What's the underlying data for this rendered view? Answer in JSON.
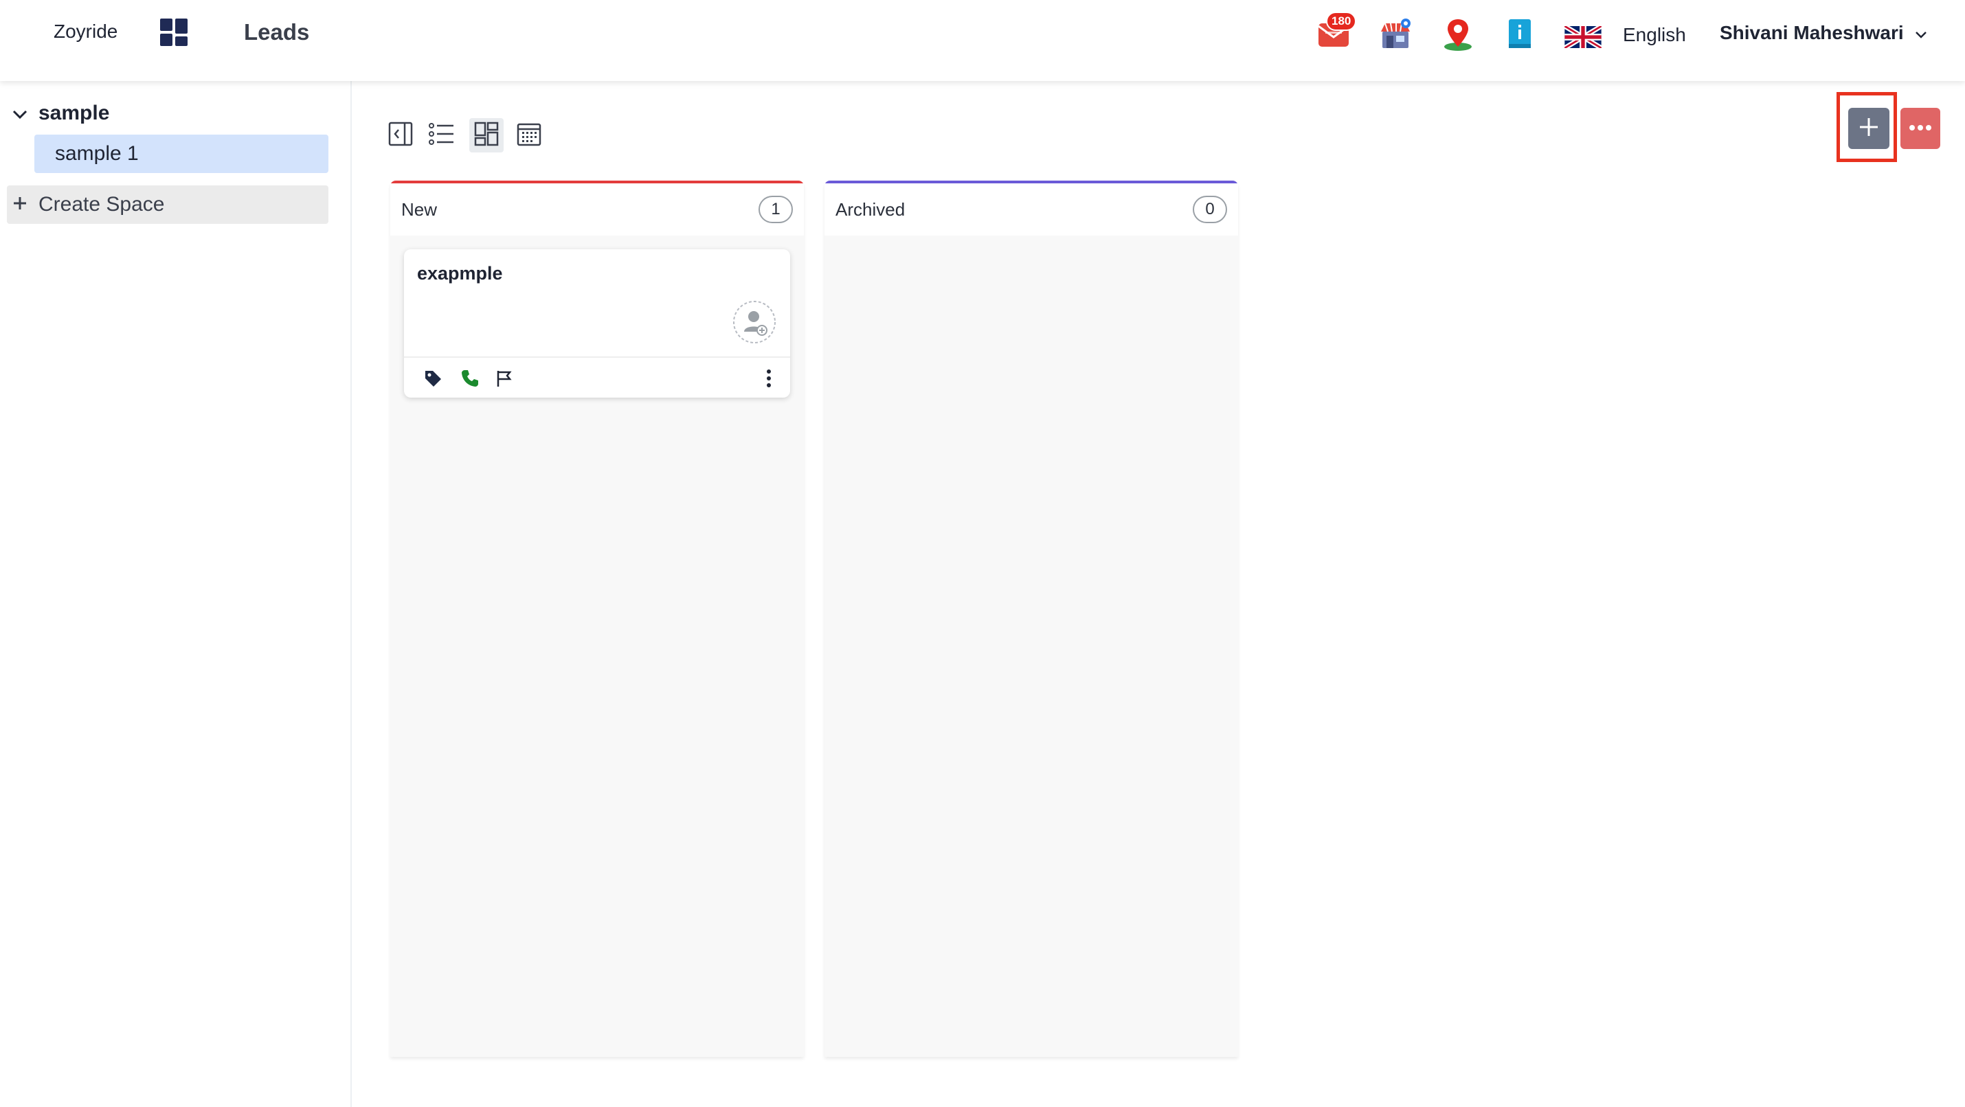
{
  "topbar": {
    "brand": "Zoyride",
    "module_title": "Leads",
    "notification_count": "180",
    "language": "English",
    "user_name": "Shivani Maheshwari"
  },
  "sidebar": {
    "space": {
      "name": "sample",
      "expanded": true
    },
    "subspaces": [
      {
        "label": "sample 1",
        "selected": true
      }
    ],
    "create_space_label": "Create Space"
  },
  "toolbar": {
    "views": [
      "collapse-sidebar",
      "list-view",
      "board-view",
      "calendar-view"
    ],
    "active_view": "board-view",
    "add_button_highlighted": true
  },
  "board": {
    "columns": [
      {
        "title": "New",
        "count": "1",
        "accent_color": "#e33c3c",
        "cards": [
          {
            "title": "exapmple"
          }
        ]
      },
      {
        "title": "Archived",
        "count": "0",
        "accent_color": "#6a5ad8",
        "cards": []
      }
    ]
  },
  "colors": {
    "add_button": "#6c7486",
    "more_button": "#e06565",
    "highlight": "#e8321f",
    "selected_subspace": "#d3e3fc",
    "phone_icon": "#1b8a2e"
  }
}
